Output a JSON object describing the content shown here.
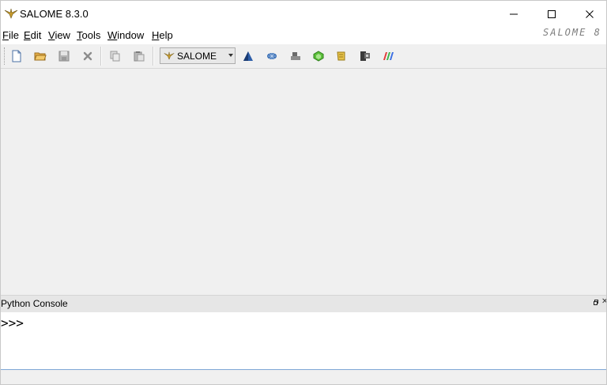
{
  "window": {
    "title": "SALOME 8.3.0",
    "controls": {
      "minimize_icon": "minimize-icon",
      "maximize_icon": "maximize-icon",
      "close_icon": "close-icon"
    }
  },
  "menubar": {
    "items": [
      {
        "mnemonic": "F",
        "rest": "ile"
      },
      {
        "mnemonic": "E",
        "rest": "dit"
      },
      {
        "mnemonic": "V",
        "rest": "iew"
      },
      {
        "mnemonic": "T",
        "rest": "ools"
      },
      {
        "mnemonic": "W",
        "rest": "indow"
      },
      {
        "mnemonic": "H",
        "rest": "elp"
      }
    ],
    "brand": "SALOME 8"
  },
  "toolbar": {
    "file_actions": [
      "new-document-icon",
      "open-folder-icon",
      "save-icon",
      "close-document-icon"
    ],
    "edit_actions": [
      "copy-icon",
      "paste-icon"
    ],
    "module_selector": {
      "value": "SALOME"
    },
    "modules": [
      "geometry-module-icon",
      "mesh-module-icon",
      "yacs-module-icon",
      "smesh-module-icon",
      "jobmanager-module-icon",
      "paravis-module-icon",
      "visualization-module-icon"
    ]
  },
  "python_console": {
    "title": "Python Console",
    "prompt": ">>>"
  },
  "colors": {
    "accent_border": "#7ea7d6",
    "background": "#f0f0f0",
    "logo_gold": "#c89b2c"
  }
}
